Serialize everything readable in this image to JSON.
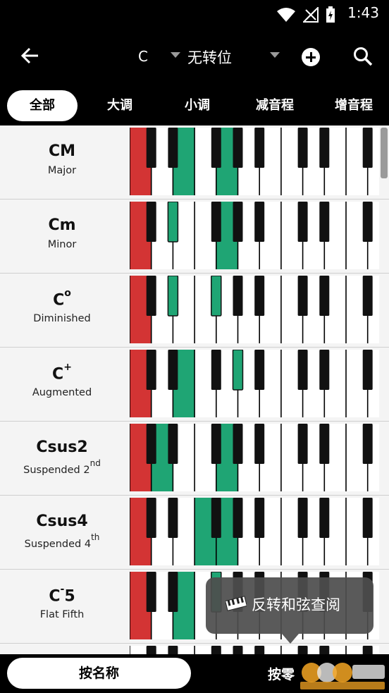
{
  "status_bar": {
    "time": "1:43"
  },
  "toolbar": {
    "key": "C",
    "inversion": "无转位"
  },
  "tabs": [
    {
      "label": "全部",
      "active": true
    },
    {
      "label": "大调",
      "active": false
    },
    {
      "label": "小调",
      "active": false
    },
    {
      "label": "减音程",
      "active": false
    },
    {
      "label": "增音程",
      "active": false
    }
  ],
  "colors": {
    "root": "#d33434",
    "note": "#1fa574"
  },
  "chords": [
    {
      "name": "CM",
      "sup": "",
      "name_suffix": "",
      "desc": "Major",
      "desc_sup": "",
      "notes": [
        0,
        4,
        7
      ]
    },
    {
      "name": "Cm",
      "sup": "",
      "name_suffix": "",
      "desc": "Minor",
      "desc_sup": "",
      "notes": [
        0,
        3,
        7
      ]
    },
    {
      "name": "C",
      "sup": "o",
      "name_suffix": "",
      "desc": "Diminished",
      "desc_sup": "",
      "notes": [
        0,
        3,
        6
      ]
    },
    {
      "name": "C",
      "sup": "+",
      "name_suffix": "",
      "desc": "Augmented",
      "desc_sup": "",
      "notes": [
        0,
        4,
        8
      ]
    },
    {
      "name": "Csus2",
      "sup": "",
      "name_suffix": "",
      "desc": "Suspended 2",
      "desc_sup": "nd",
      "notes": [
        0,
        2,
        7
      ]
    },
    {
      "name": "Csus4",
      "sup": "",
      "name_suffix": "",
      "desc": "Suspended 4",
      "desc_sup": "th",
      "notes": [
        0,
        5,
        7
      ]
    },
    {
      "name": "C",
      "sup": "-",
      "name_suffix": "5",
      "desc": "Flat Fifth",
      "desc_sup": "",
      "notes": [
        0,
        4,
        6
      ]
    }
  ],
  "toast": {
    "text": "反转和弦查阅"
  },
  "bottom": {
    "by_name": "按名称",
    "by_note": "按零"
  }
}
